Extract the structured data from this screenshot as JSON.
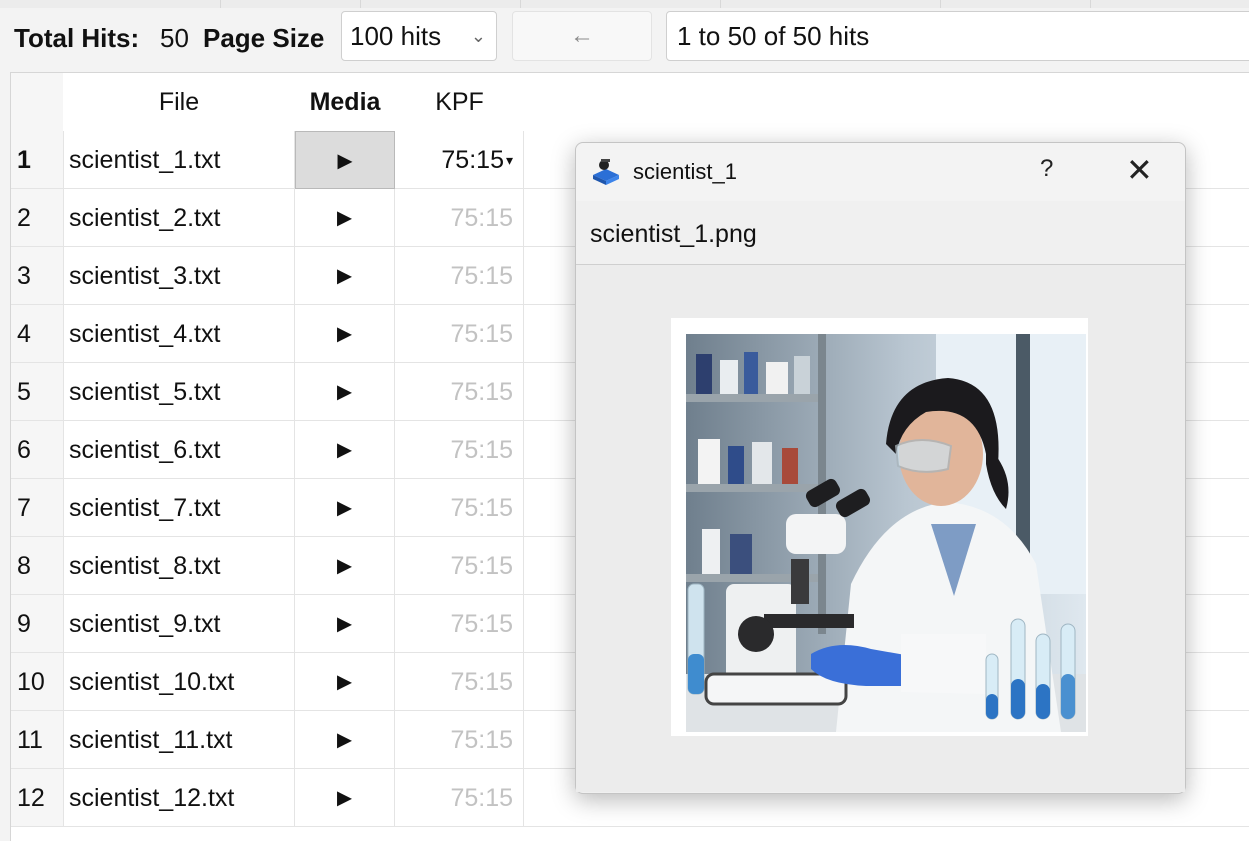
{
  "toolbar": {
    "total_hits_label": "Total Hits:",
    "total_hits_value": "50",
    "page_size_label": "Page Size",
    "page_size_value": "100 hits",
    "prev_label": "←",
    "range_text": "1 to 50 of 50 hits"
  },
  "table": {
    "headers": {
      "file": "File",
      "media": "Media",
      "kpf": "KPF"
    },
    "rows": [
      {
        "num": "1",
        "file": "scientist_1.txt",
        "media": "►",
        "kpf": "75:15"
      },
      {
        "num": "2",
        "file": "scientist_2.txt",
        "media": "►",
        "kpf": "75:15"
      },
      {
        "num": "3",
        "file": "scientist_3.txt",
        "media": "►",
        "kpf": "75:15"
      },
      {
        "num": "4",
        "file": "scientist_4.txt",
        "media": "►",
        "kpf": "75:15"
      },
      {
        "num": "5",
        "file": "scientist_5.txt",
        "media": "►",
        "kpf": "75:15"
      },
      {
        "num": "6",
        "file": "scientist_6.txt",
        "media": "►",
        "kpf": "75:15"
      },
      {
        "num": "7",
        "file": "scientist_7.txt",
        "media": "►",
        "kpf": "75:15"
      },
      {
        "num": "8",
        "file": "scientist_8.txt",
        "media": "►",
        "kpf": "75:15"
      },
      {
        "num": "9",
        "file": "scientist_9.txt",
        "media": "►",
        "kpf": "75:15"
      },
      {
        "num": "10",
        "file": "scientist_10.txt",
        "media": "►",
        "kpf": "75:15"
      },
      {
        "num": "11",
        "file": "scientist_11.txt",
        "media": "►",
        "kpf": "75:15"
      },
      {
        "num": "12",
        "file": "scientist_12.txt",
        "media": "►",
        "kpf": "75:15"
      }
    ],
    "selected_kpf_caret": "▾"
  },
  "dialog": {
    "title": "scientist_1",
    "help": "?",
    "close": "✕",
    "filename": "scientist_1.png",
    "icon": "app-icon"
  },
  "colors": {
    "accent_blue": "#2b6fd6",
    "glove_blue": "#3a6fd8",
    "muted_text": "#c2c2c2"
  }
}
